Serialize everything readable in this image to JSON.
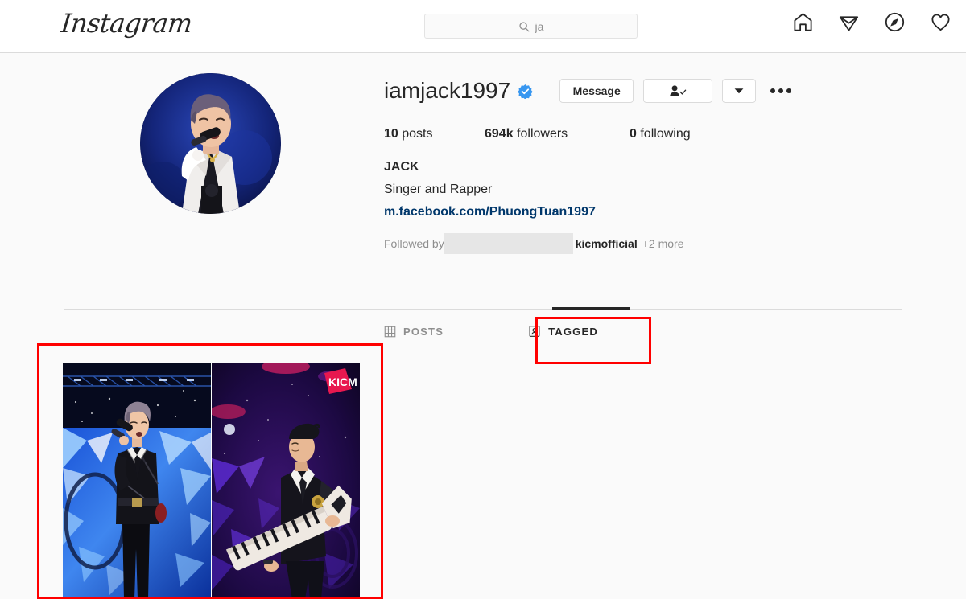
{
  "header": {
    "logo_text": "Instagram",
    "search": {
      "icon": "search-icon",
      "value": "ja",
      "placeholder": "Search"
    },
    "nav": [
      {
        "name": "home-icon",
        "label": "Home"
      },
      {
        "name": "direct-icon",
        "label": "Direct"
      },
      {
        "name": "explore-icon",
        "label": "Explore"
      },
      {
        "name": "activity-icon",
        "label": "Activity"
      }
    ]
  },
  "profile": {
    "avatar_alt": "profile-photo",
    "username": "iamjack1997",
    "verified": true,
    "verified_color": "#3897f0",
    "buttons": {
      "message": "Message",
      "following_icon": "person-check-icon",
      "caret_icon": "chevron-down-icon",
      "more_icon": "more-options-icon"
    },
    "stats": {
      "posts_count": "10",
      "posts_label": "posts",
      "followers_count": "694k",
      "followers_label": "followers",
      "following_count": "0",
      "following_label": "following"
    },
    "bio": {
      "full_name": "JACK",
      "description": "Singer and Rapper",
      "link": "m.facebook.com/PhuongTuan1997",
      "link_color": "#00376b"
    },
    "followed_by": {
      "prefix": "Followed by",
      "redacted": "",
      "name": "kicmofficial",
      "more": "+2 more"
    }
  },
  "tabs": [
    {
      "name": "tab-posts",
      "label": "POSTS",
      "icon": "grid-icon",
      "active": false
    },
    {
      "name": "tab-tagged",
      "label": "TAGGED",
      "icon": "tagged-person-icon",
      "active": true
    }
  ],
  "grid": {
    "photos": [
      {
        "name": "tagged-photo-1",
        "alt": "singer in black suit with microphone on blue crystal stage"
      },
      {
        "name": "tagged-photo-2",
        "alt": "performer with white keytar under purple stage lights",
        "watermark": "KICM"
      }
    ]
  },
  "annotations": [
    {
      "name": "annotation-tagged-tab",
      "color": "#ff0000"
    },
    {
      "name": "annotation-photo-grid",
      "color": "#ff0000"
    }
  ]
}
